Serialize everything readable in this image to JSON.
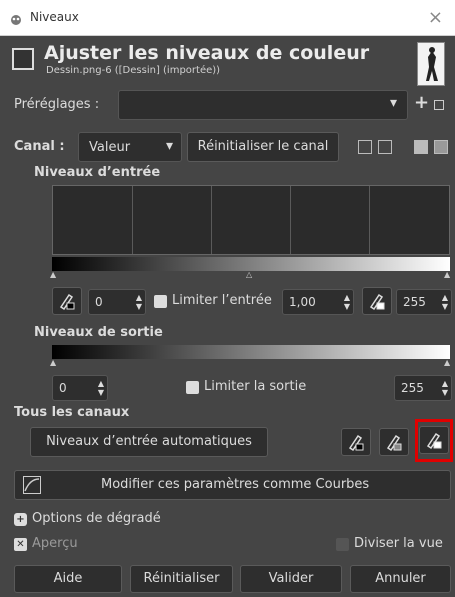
{
  "window": {
    "title": "Niveaux",
    "close_glyph": "×"
  },
  "header": {
    "title": "Ajuster les niveaux de couleur",
    "subtitle": "Dessin.png-6 ([Dessin] (importée))"
  },
  "presets": {
    "label": "Préréglages :",
    "value": ""
  },
  "canal": {
    "label": "Canal :",
    "value": "Valeur",
    "reset_label": "Réinitialiser le canal"
  },
  "input_levels": {
    "title": "Niveaux d’entrée",
    "low": "0",
    "clamp_label": "Limiter l’entrée",
    "gamma": "1,00",
    "high": "255"
  },
  "output_levels": {
    "title": "Niveaux de sortie",
    "low": "0",
    "clamp_label": "Limiter la sortie",
    "high": "255"
  },
  "all_channels": {
    "title": "Tous les canaux",
    "auto_label": "Niveaux d’entrée automatiques"
  },
  "curves_label": "Modifier ces paramètres comme Courbes",
  "blend_options_label": "Options de dégradé",
  "preview_label": "Aperçu",
  "split_view_label": "Diviser la vue",
  "buttons": {
    "help": "Aide",
    "reset": "Réinitialiser",
    "ok": "Valider",
    "cancel": "Annuler"
  },
  "icons": [
    "levels-icon",
    "close-icon",
    "chevron-down-icon",
    "plus-icon",
    "menu-icon",
    "black-point-picker-icon",
    "gray-point-picker-icon",
    "white-point-picker-icon",
    "curves-icon"
  ],
  "highlight_color": "#e00000"
}
